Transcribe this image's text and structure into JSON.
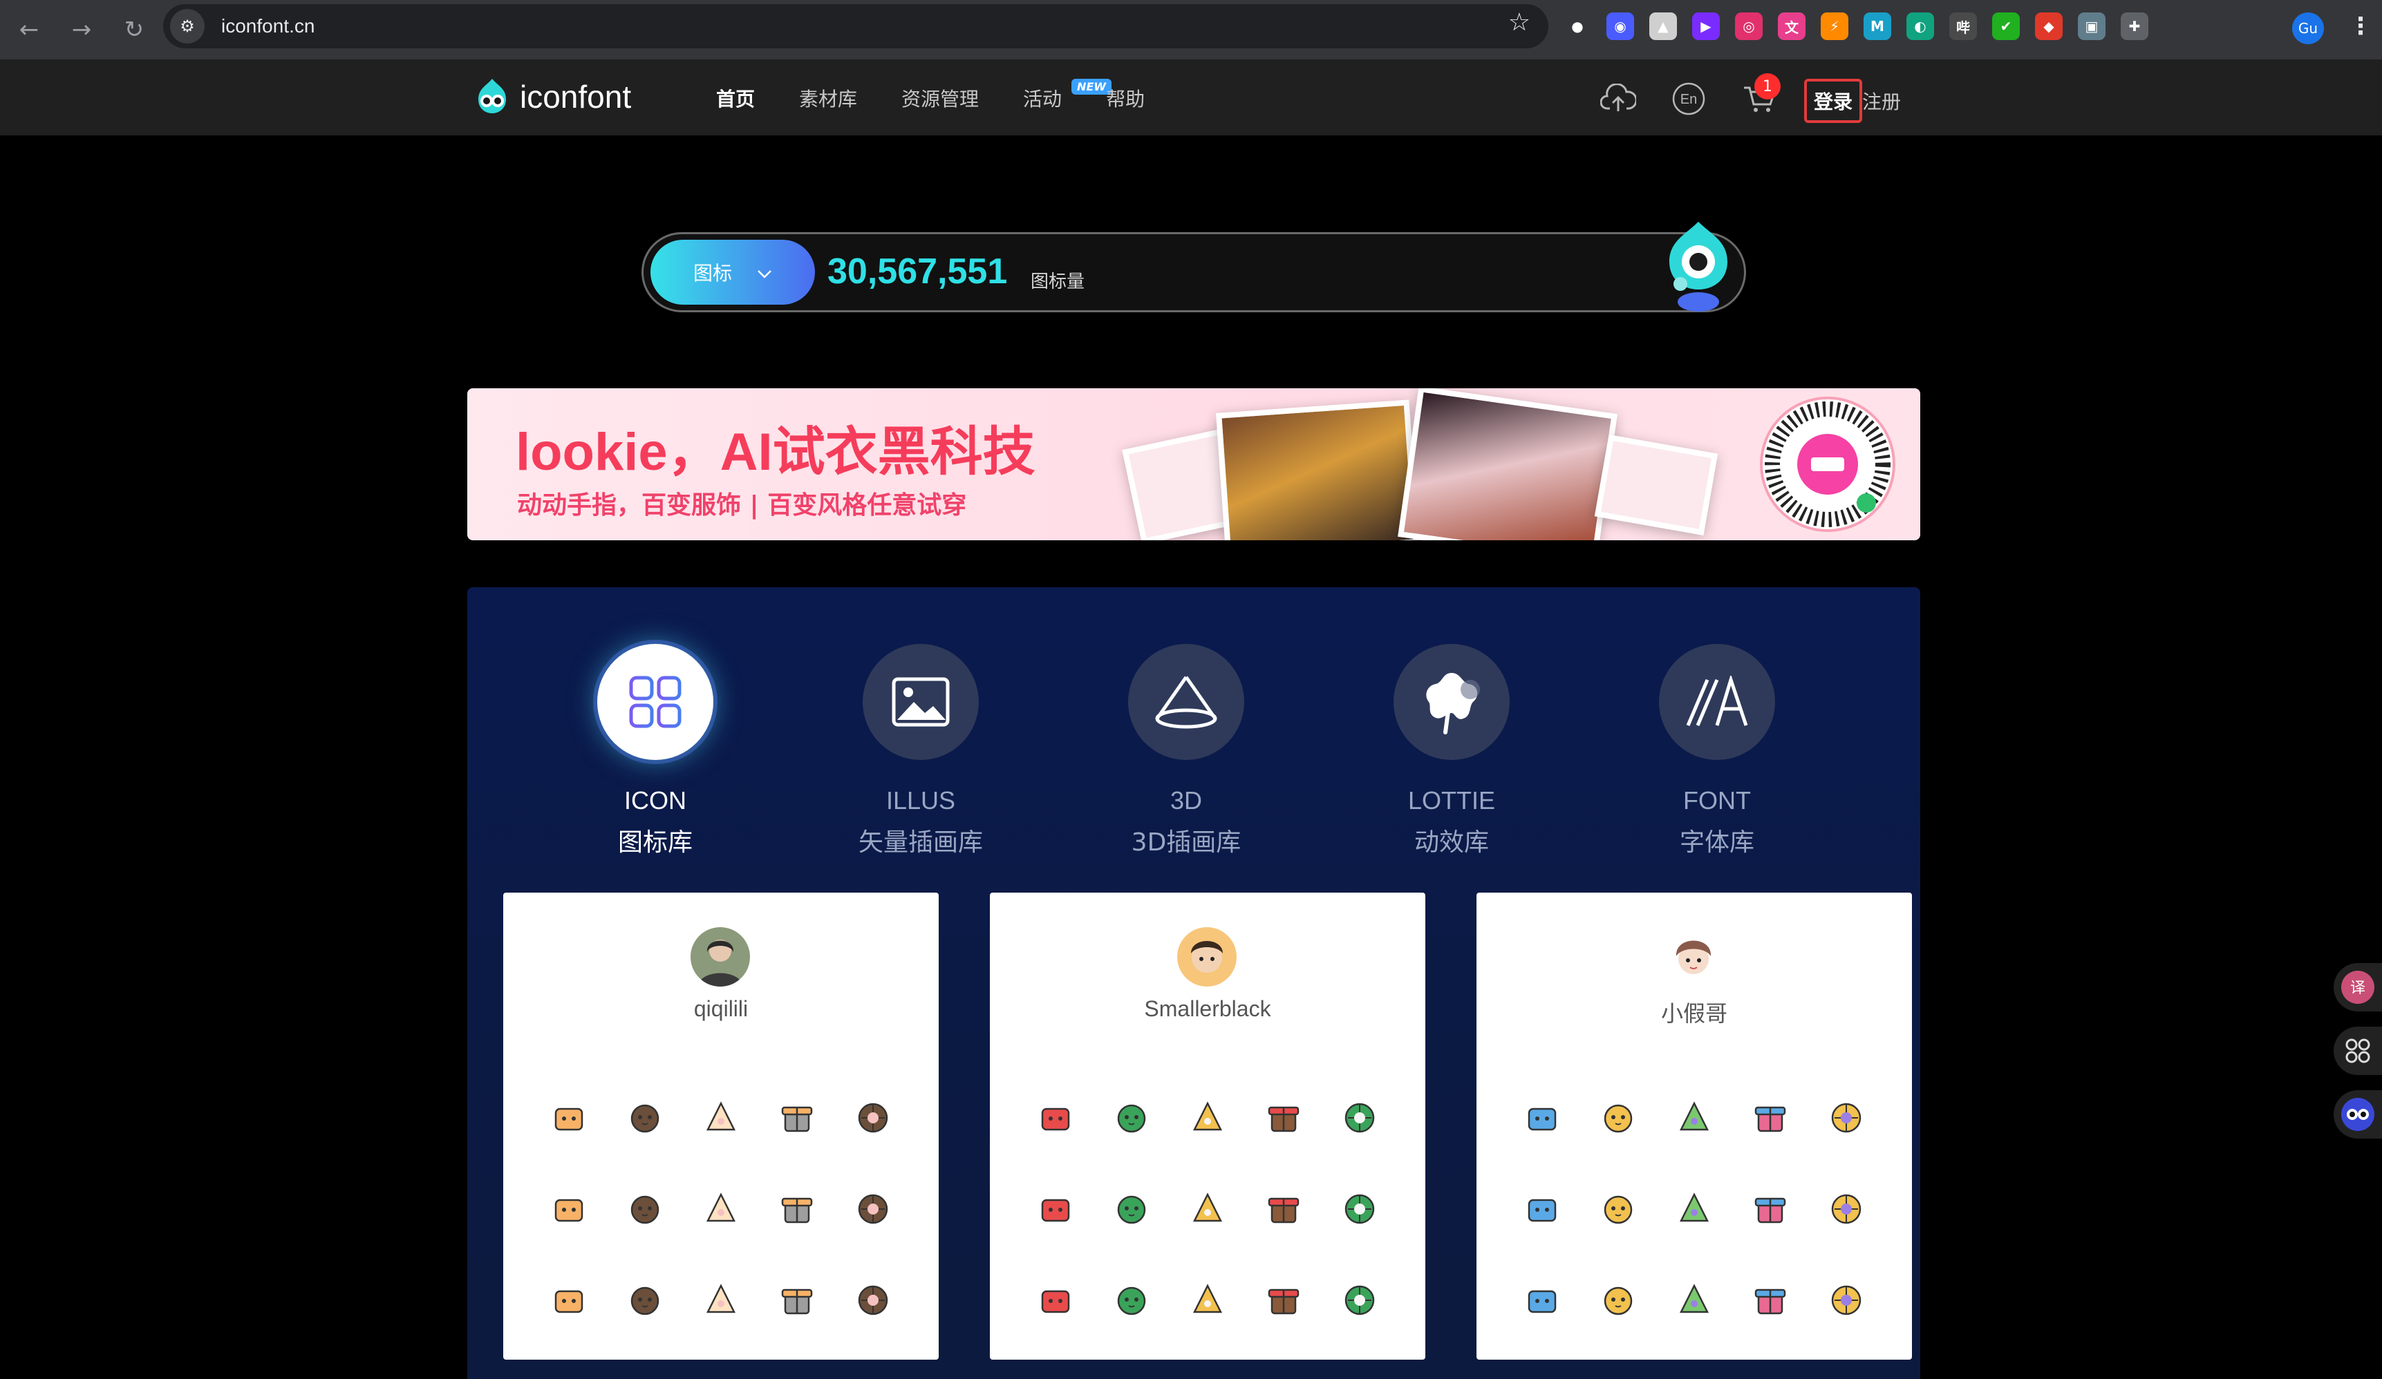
{
  "browser": {
    "url": "iconfont.cn",
    "profile_initials": "Gu",
    "extensions": [
      {
        "icon": "panda-ext-icon",
        "color": "#ffffff",
        "glyph": "●"
      },
      {
        "icon": "owl-ext-icon",
        "color": "#4a5cff",
        "glyph": "◉"
      },
      {
        "icon": "triangle-ext-icon",
        "color": "#cfcfcf",
        "glyph": "▲"
      },
      {
        "icon": "play-ext-icon",
        "color": "#7a2cff",
        "glyph": "▶"
      },
      {
        "icon": "insta-ext-icon",
        "color": "#e1306c",
        "glyph": "◎"
      },
      {
        "icon": "translate-ext-icon",
        "color": "#e83e8c",
        "glyph": "文"
      },
      {
        "icon": "bolt-ext-icon",
        "color": "#ff8a00",
        "glyph": "⚡"
      },
      {
        "icon": "m-ext-icon",
        "color": "#19a0c8",
        "glyph": "M"
      },
      {
        "icon": "chat-ext-icon",
        "color": "#10a37f",
        "glyph": "◐"
      },
      {
        "icon": "bili-ext-icon",
        "color": "#4a4a4a",
        "glyph": "哔"
      },
      {
        "icon": "check-ext-icon",
        "color": "#20b020",
        "glyph": "✔"
      },
      {
        "icon": "shield-ext-icon",
        "color": "#e0392a",
        "glyph": "◆"
      },
      {
        "icon": "cube-ext-icon",
        "color": "#607d8b",
        "glyph": "▣"
      },
      {
        "icon": "puzzle-ext-icon",
        "color": "#5f6368",
        "glyph": "✚"
      }
    ]
  },
  "header": {
    "logo_text": "iconfont",
    "nav": [
      {
        "label": "首页",
        "active": true
      },
      {
        "label": "素材库",
        "active": false
      },
      {
        "label": "资源管理",
        "active": false
      },
      {
        "label": "活动",
        "active": false,
        "badge": "NEW"
      },
      {
        "label": "帮助",
        "active": false
      }
    ],
    "lang_toggle": "En",
    "cart_count": "1",
    "login_label": "登录",
    "register_label": "注册"
  },
  "counter": {
    "type_label": "图标",
    "value": "30,567,551",
    "unit_label": "图标量"
  },
  "banner": {
    "title": "lookie，AI试衣黑科技",
    "subtitle": "动动手指，百变服饰 | 百变风格任意试穿"
  },
  "categories": [
    {
      "en": "ICON",
      "cn": "图标库",
      "icon": "grid-icon",
      "active": true
    },
    {
      "en": "ILLUS",
      "cn": "矢量插画库",
      "icon": "image-icon",
      "active": false
    },
    {
      "en": "3D",
      "cn": "3D插画库",
      "icon": "cone-icon",
      "active": false
    },
    {
      "en": "LOTTIE",
      "cn": "动效库",
      "icon": "flower-icon",
      "active": false
    },
    {
      "en": "FONT",
      "cn": "字体库",
      "icon": "font-a-icon",
      "active": false
    }
  ],
  "cards": [
    {
      "user": "qiqilili",
      "avatar_color": "#8a9a7a",
      "icons": [
        "box-cat",
        "hamster",
        "shiba",
        "cat-striped",
        "dog-white",
        "rottweiler",
        "tuxedo-cat",
        "white-cat",
        "husky",
        "pig",
        "duck",
        "orange-cat",
        "gray-cat",
        "black-cat",
        "cow-cat"
      ]
    },
    {
      "user": "Smallerblack",
      "avatar_color": "#f4b76a",
      "icons": [
        "gift-bow",
        "candy-cane",
        "holly",
        "pudding",
        "present",
        "santa-hat-cake",
        "ornament",
        "gift-box",
        "santa-hat",
        "reindeer",
        "holly-leaf",
        "house",
        "wreath",
        "cane",
        "gingerbread"
      ]
    },
    {
      "user": "小假哥",
      "avatar_color": "#c8a79a",
      "icons": [
        "jar",
        "crossed-clubs",
        "bowling",
        "treadmill",
        "scooter",
        "kettlebell",
        "ping-pong",
        "jersey",
        "stopwatch",
        "target",
        "volleyball",
        "bandage",
        "hockey-stick",
        "ball",
        "glove"
      ]
    }
  ]
}
